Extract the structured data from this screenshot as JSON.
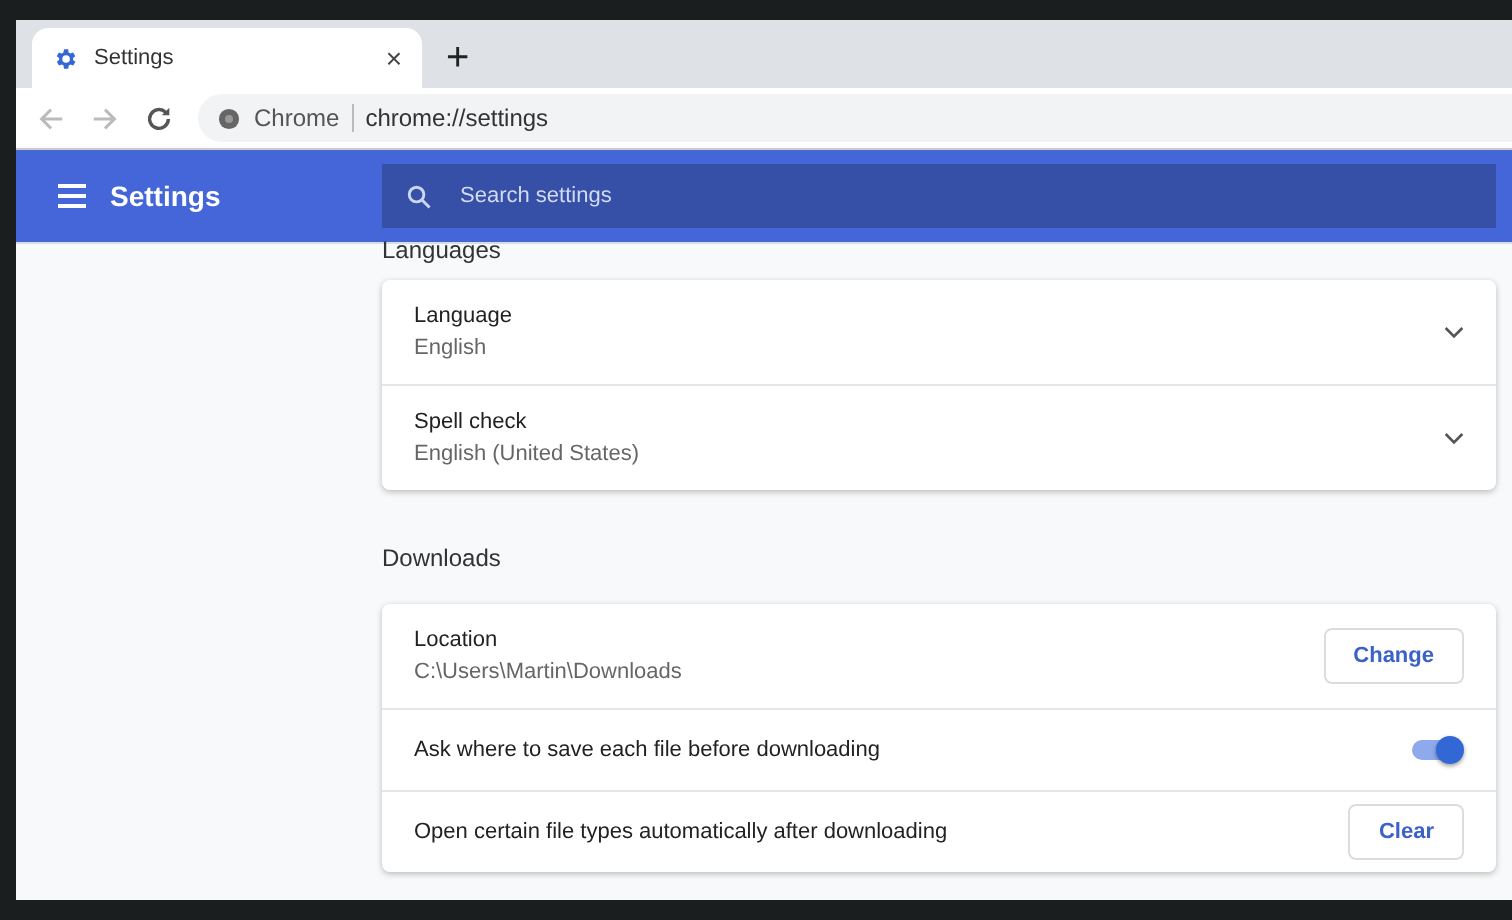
{
  "tab": {
    "title": "Settings",
    "close": "×",
    "new_tab": "+"
  },
  "address_bar": {
    "site": "Chrome",
    "url": "chrome://settings"
  },
  "header": {
    "title": "Settings",
    "search": {
      "placeholder": "Search settings"
    }
  },
  "sections": [
    {
      "heading": "Languages",
      "items": [
        {
          "kind": "expand",
          "label": "Language",
          "value": "English",
          "expanded": false
        },
        {
          "kind": "expand",
          "label": "Spell check",
          "value": "English (United States)",
          "expanded": false
        }
      ]
    },
    {
      "heading": "Downloads",
      "items": [
        {
          "kind": "button",
          "label": "Location",
          "value": "C:\\Users\\Martin\\Downloads",
          "button": "Change"
        },
        {
          "kind": "toggle",
          "label": "Ask where to save each file before downloading",
          "on": true
        },
        {
          "kind": "button",
          "label": "Open certain file types automatically after downloading",
          "button": "Clear"
        }
      ]
    }
  ]
}
